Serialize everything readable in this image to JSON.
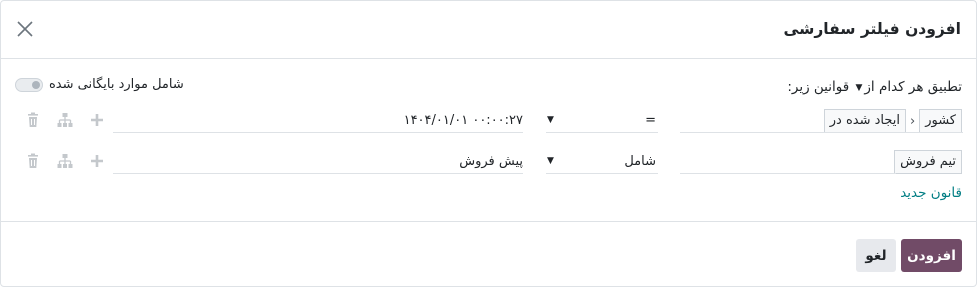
{
  "dialog": {
    "title": "افزودن فیلتر سفارشی",
    "close_icon": "close-icon"
  },
  "match": {
    "prefix": "تطبیق هر",
    "selector": "کدام از",
    "suffix": "قوانین زیر:",
    "caret_icon": "caret-down-icon"
  },
  "archived": {
    "label": "شامل موارد بایگانی شده",
    "enabled": false
  },
  "rules": [
    {
      "path": [
        "کشور",
        "ایجاد شده در"
      ],
      "separator": "›",
      "operator": "=",
      "value": "۱۴۰۴/۰۱/۰۱ ۰۰:۰۰:۲۷"
    },
    {
      "path": [
        "تیم فروش"
      ],
      "operator": "شامل",
      "value": "پیش فروش"
    }
  ],
  "actions": {
    "add_icon": "plus-icon",
    "branch_icon": "sitemap-icon",
    "delete_icon": "trash-icon"
  },
  "new_rule_label": "قانون جدید",
  "footer": {
    "confirm_label": "افزودن",
    "cancel_label": "لغو"
  },
  "colors": {
    "primary": "#714b67",
    "link": "#017e84",
    "muted_icon": "#c4c8cc"
  }
}
